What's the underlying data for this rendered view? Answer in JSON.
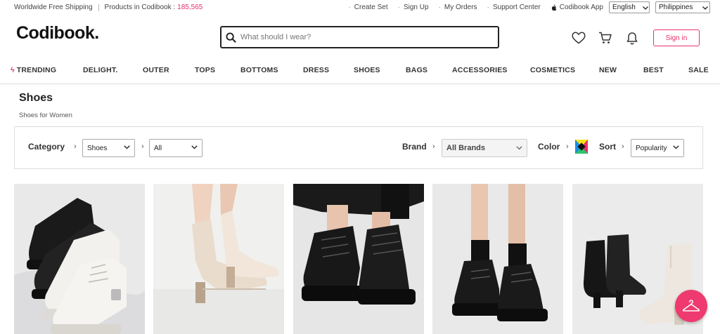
{
  "topbar": {
    "free_shipping": "Worldwide Free Shipping",
    "products_label": "Products in Codibook :",
    "products_count": "185,565",
    "links": [
      "Create Set",
      "Sign Up",
      "My Orders",
      "Support Center"
    ],
    "app_label": "Codibook App",
    "language": "English",
    "country": "Philippines"
  },
  "header": {
    "logo": "Codibook.",
    "search_placeholder": "What should I wear?",
    "signin_label": "Sign in"
  },
  "nav": {
    "items": [
      "TRENDING",
      "DELIGHT.",
      "OUTER",
      "TOPS",
      "BOTTOMS",
      "DRESS",
      "SHOES",
      "BAGS",
      "ACCESSORIES",
      "COSMETICS",
      "NEW",
      "BEST",
      "SALE"
    ]
  },
  "page": {
    "title": "Shoes",
    "subtitle": "Shoes for Women"
  },
  "filters": {
    "category_label": "Category",
    "category_value": "Shoes",
    "subcategory_value": "All",
    "brand_label": "Brand",
    "brand_value": "All Brands",
    "color_label": "Color",
    "sort_label": "Sort",
    "sort_value": "Popularity"
  },
  "products": [
    {
      "name": "lace-up-combat-boots-black-white"
    },
    {
      "name": "ivory-sock-ankle-boots"
    },
    {
      "name": "black-lace-up-chunky-boots"
    },
    {
      "name": "black-chunky-derby-loafers"
    },
    {
      "name": "black-and-ivory-ankle-boots"
    }
  ],
  "colors": {
    "accent": "#e8306a",
    "fab": "#ee3a6f"
  }
}
